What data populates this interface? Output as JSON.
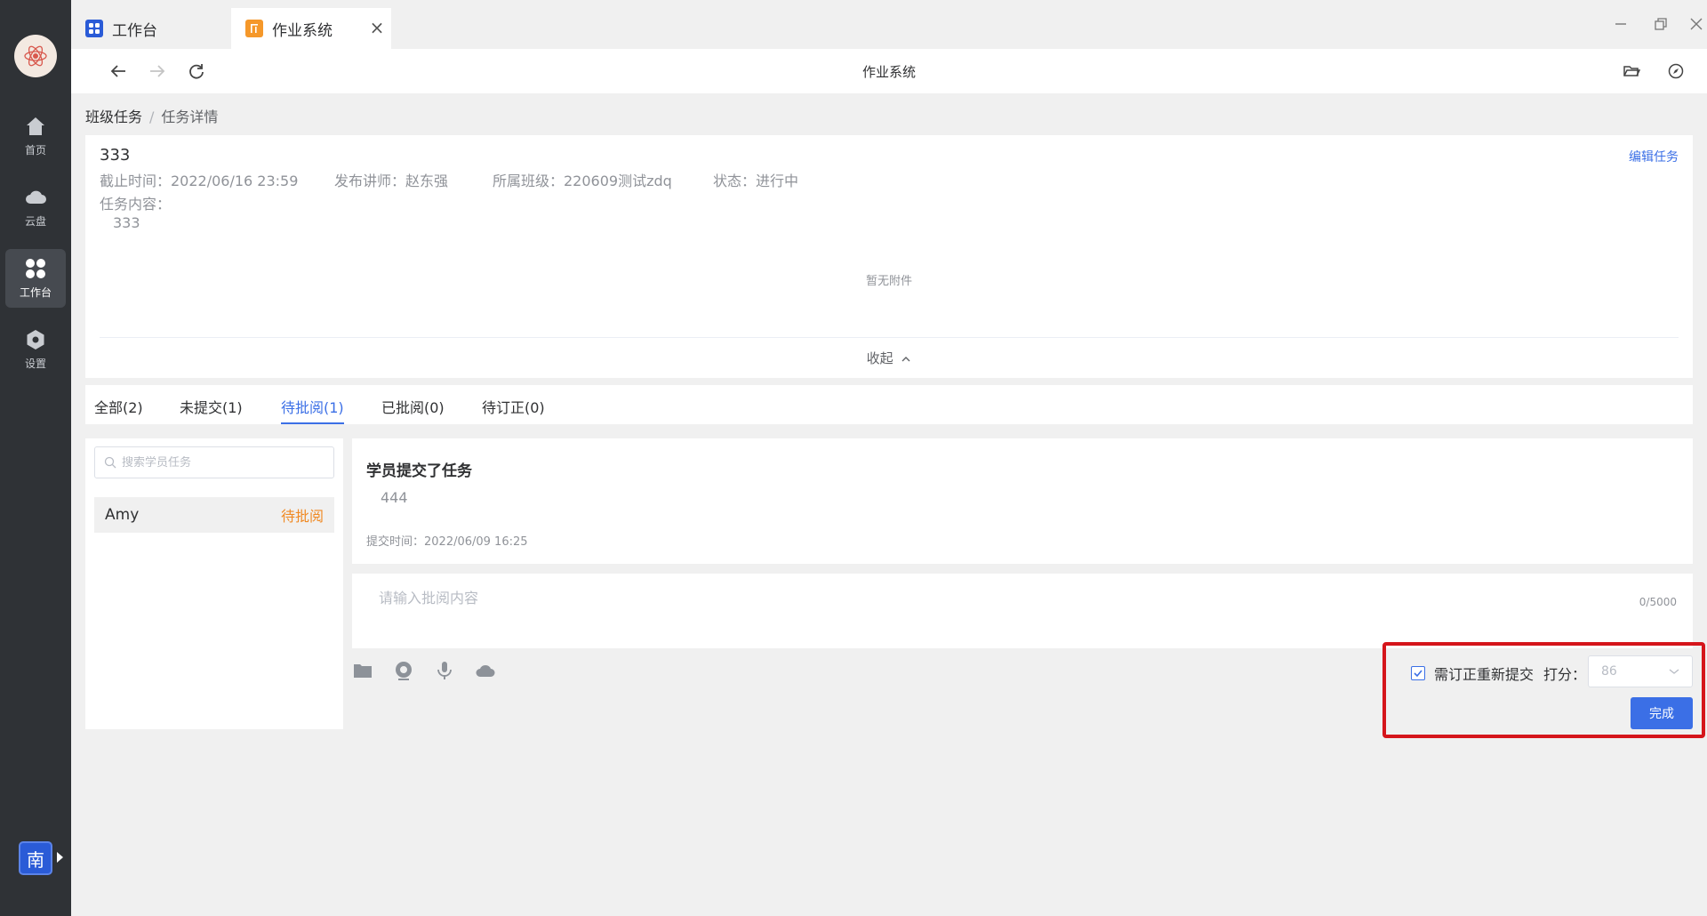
{
  "tabs": [
    {
      "label": "工作台",
      "icon": "workbench-icon"
    },
    {
      "label": "作业系统",
      "icon": "homework-app-icon",
      "active": true,
      "close": "×"
    }
  ],
  "addressbar": {
    "title": "作业系统"
  },
  "rail": {
    "items": [
      {
        "label": "首页",
        "icon": "home-icon"
      },
      {
        "label": "云盘",
        "icon": "cloud-icon"
      },
      {
        "label": "工作台",
        "icon": "grid-icon",
        "active": true
      },
      {
        "label": "设置",
        "icon": "settings-icon"
      }
    ],
    "user_badge": "南"
  },
  "breadcrumb": {
    "parent": "班级任务",
    "separator": "/",
    "current": "任务详情"
  },
  "task": {
    "name": "333",
    "edit_label": "编辑任务",
    "deadline": "截止时间：2022/06/16 23:59",
    "teacher": "发布讲师：赵东强",
    "class": "所属班级：220609测试zdq",
    "status": "状态：进行中",
    "content_label": "任务内容：",
    "content": "333",
    "no_attachment": "暂无附件",
    "collapse_label": "收起"
  },
  "filters": [
    {
      "label": "全部(2)"
    },
    {
      "label": "未提交(1)"
    },
    {
      "label": "待批阅(1)",
      "active": true
    },
    {
      "label": "已批阅(0)"
    },
    {
      "label": "待订正(0)"
    }
  ],
  "student_search": {
    "placeholder": "搜索学员任务"
  },
  "students": [
    {
      "name": "Amy",
      "status": "待批阅",
      "status_color": "#f08a24"
    }
  ],
  "submission": {
    "heading": "学员提交了任务",
    "content": "444",
    "time": "提交时间：2022/06/09 16:25"
  },
  "review": {
    "placeholder": "请输入批阅内容",
    "count": "0/5000"
  },
  "tools": [
    "folder-icon",
    "camera-icon",
    "microphone-icon",
    "cloud-upload-icon"
  ],
  "grading": {
    "resubmit_label": "需订正重新提交",
    "resubmit_checked": true,
    "score_label": "打分：",
    "score_value": "86",
    "done_label": "完成"
  },
  "colors": {
    "accent": "#3b6fe6",
    "pending": "#f08a24",
    "highlight": "#d5151b"
  }
}
